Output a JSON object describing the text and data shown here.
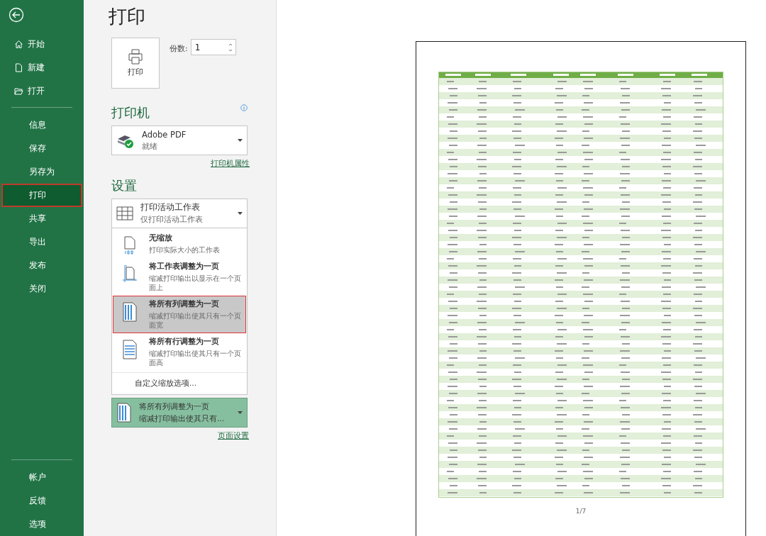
{
  "sidebar": {
    "top_items": [
      {
        "label": "开始",
        "selected": false
      },
      {
        "label": "新建",
        "selected": false
      },
      {
        "label": "打开",
        "selected": false
      }
    ],
    "items": [
      {
        "label": "信息",
        "selected": false
      },
      {
        "label": "保存",
        "selected": false
      },
      {
        "label": "另存为",
        "selected": false
      },
      {
        "label": "打印",
        "selected": true
      },
      {
        "label": "共享",
        "selected": false
      },
      {
        "label": "导出",
        "selected": false
      },
      {
        "label": "发布",
        "selected": false
      },
      {
        "label": "关闭",
        "selected": false
      }
    ],
    "footer_items": [
      {
        "label": "帐户",
        "selected": false
      },
      {
        "label": "反馈",
        "selected": false
      },
      {
        "label": "选项",
        "selected": false
      }
    ]
  },
  "title": "打印",
  "print_button": "打印",
  "copies": {
    "label": "份数:",
    "value": "1"
  },
  "printer": {
    "heading": "打印机",
    "name": "Adobe PDF",
    "status": "就绪",
    "properties_link": "打印机属性"
  },
  "settings": {
    "heading": "设置",
    "what": {
      "title": "打印活动工作表",
      "subtitle": "仅打印活动工作表"
    },
    "scaling_menu": [
      {
        "kind": "no-scale",
        "title": "无缩放",
        "desc": "打印实际大小的工作表",
        "selected": false
      },
      {
        "kind": "fit-sheet",
        "title": "将工作表调整为一页",
        "desc": "缩减打印输出以显示在一个页面上",
        "selected": false
      },
      {
        "kind": "fit-columns",
        "title": "将所有列调整为一页",
        "desc": "缩减打印输出使其只有一个页面宽",
        "selected": true
      },
      {
        "kind": "fit-rows",
        "title": "将所有行调整为一页",
        "desc": "缩减打印输出使其只有一个页面高",
        "selected": false
      },
      {
        "kind": "custom",
        "title": "自定义缩放选项...",
        "selected": false
      }
    ],
    "scaling": {
      "title": "将所有列调整为一页",
      "subtitle": "缩减打印输出使其只有..."
    },
    "page_setup_link": "页面设置"
  },
  "preview": {
    "page_number": "1/7"
  }
}
